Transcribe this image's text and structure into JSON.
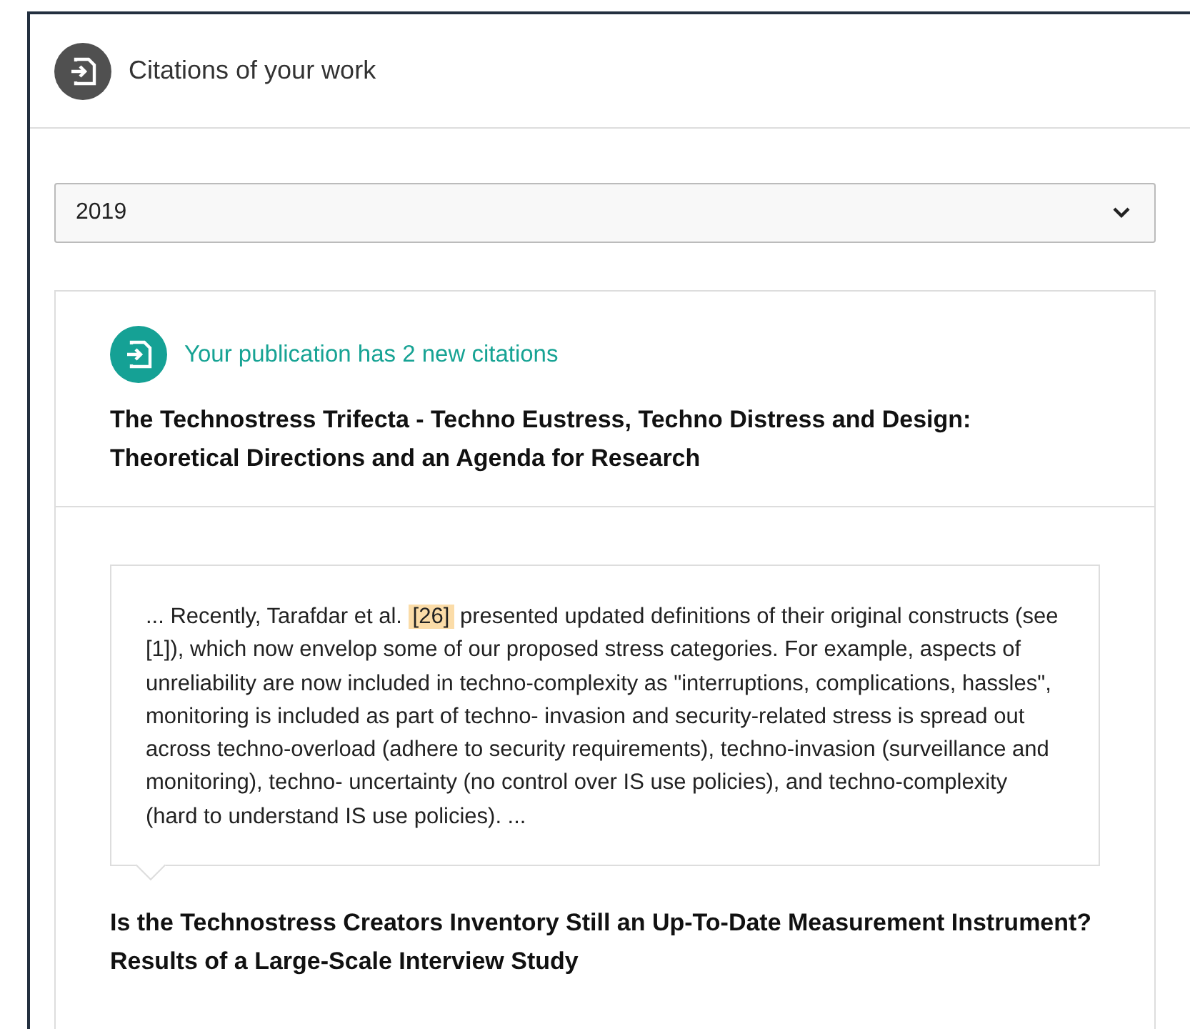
{
  "header": {
    "title": "Citations of your work"
  },
  "year_select": {
    "value": "2019"
  },
  "publication": {
    "notice": "Your publication has 2 new citations",
    "title": "The Technostress Trifecta - Techno Eustress, Techno Distress and Design: Theoretical Directions and an Agenda for Research"
  },
  "citations": [
    {
      "excerpt": {
        "before": "... Recently, Tarafdar et al.",
        "highlight": "[26]",
        "after": "presented updated definitions of their original constructs (see [1]), which now envelop some of our proposed stress categories. For example, aspects of unreliability are now included in techno-complexity as \"interruptions, complications, hassles\", monitoring is included as part of techno- invasion and security-related stress is spread out across techno-overload (adhere to security requirements), techno-invasion (surveillance and monitoring), techno- uncertainty (no control over IS use policies), and techno-complexity (hard to understand IS use policies). ..."
      },
      "title": "Is the Technostress Creators Inventory Still an Up-To-Date Measurement Instrument? Results of a Large-Scale Interview Study"
    }
  ]
}
